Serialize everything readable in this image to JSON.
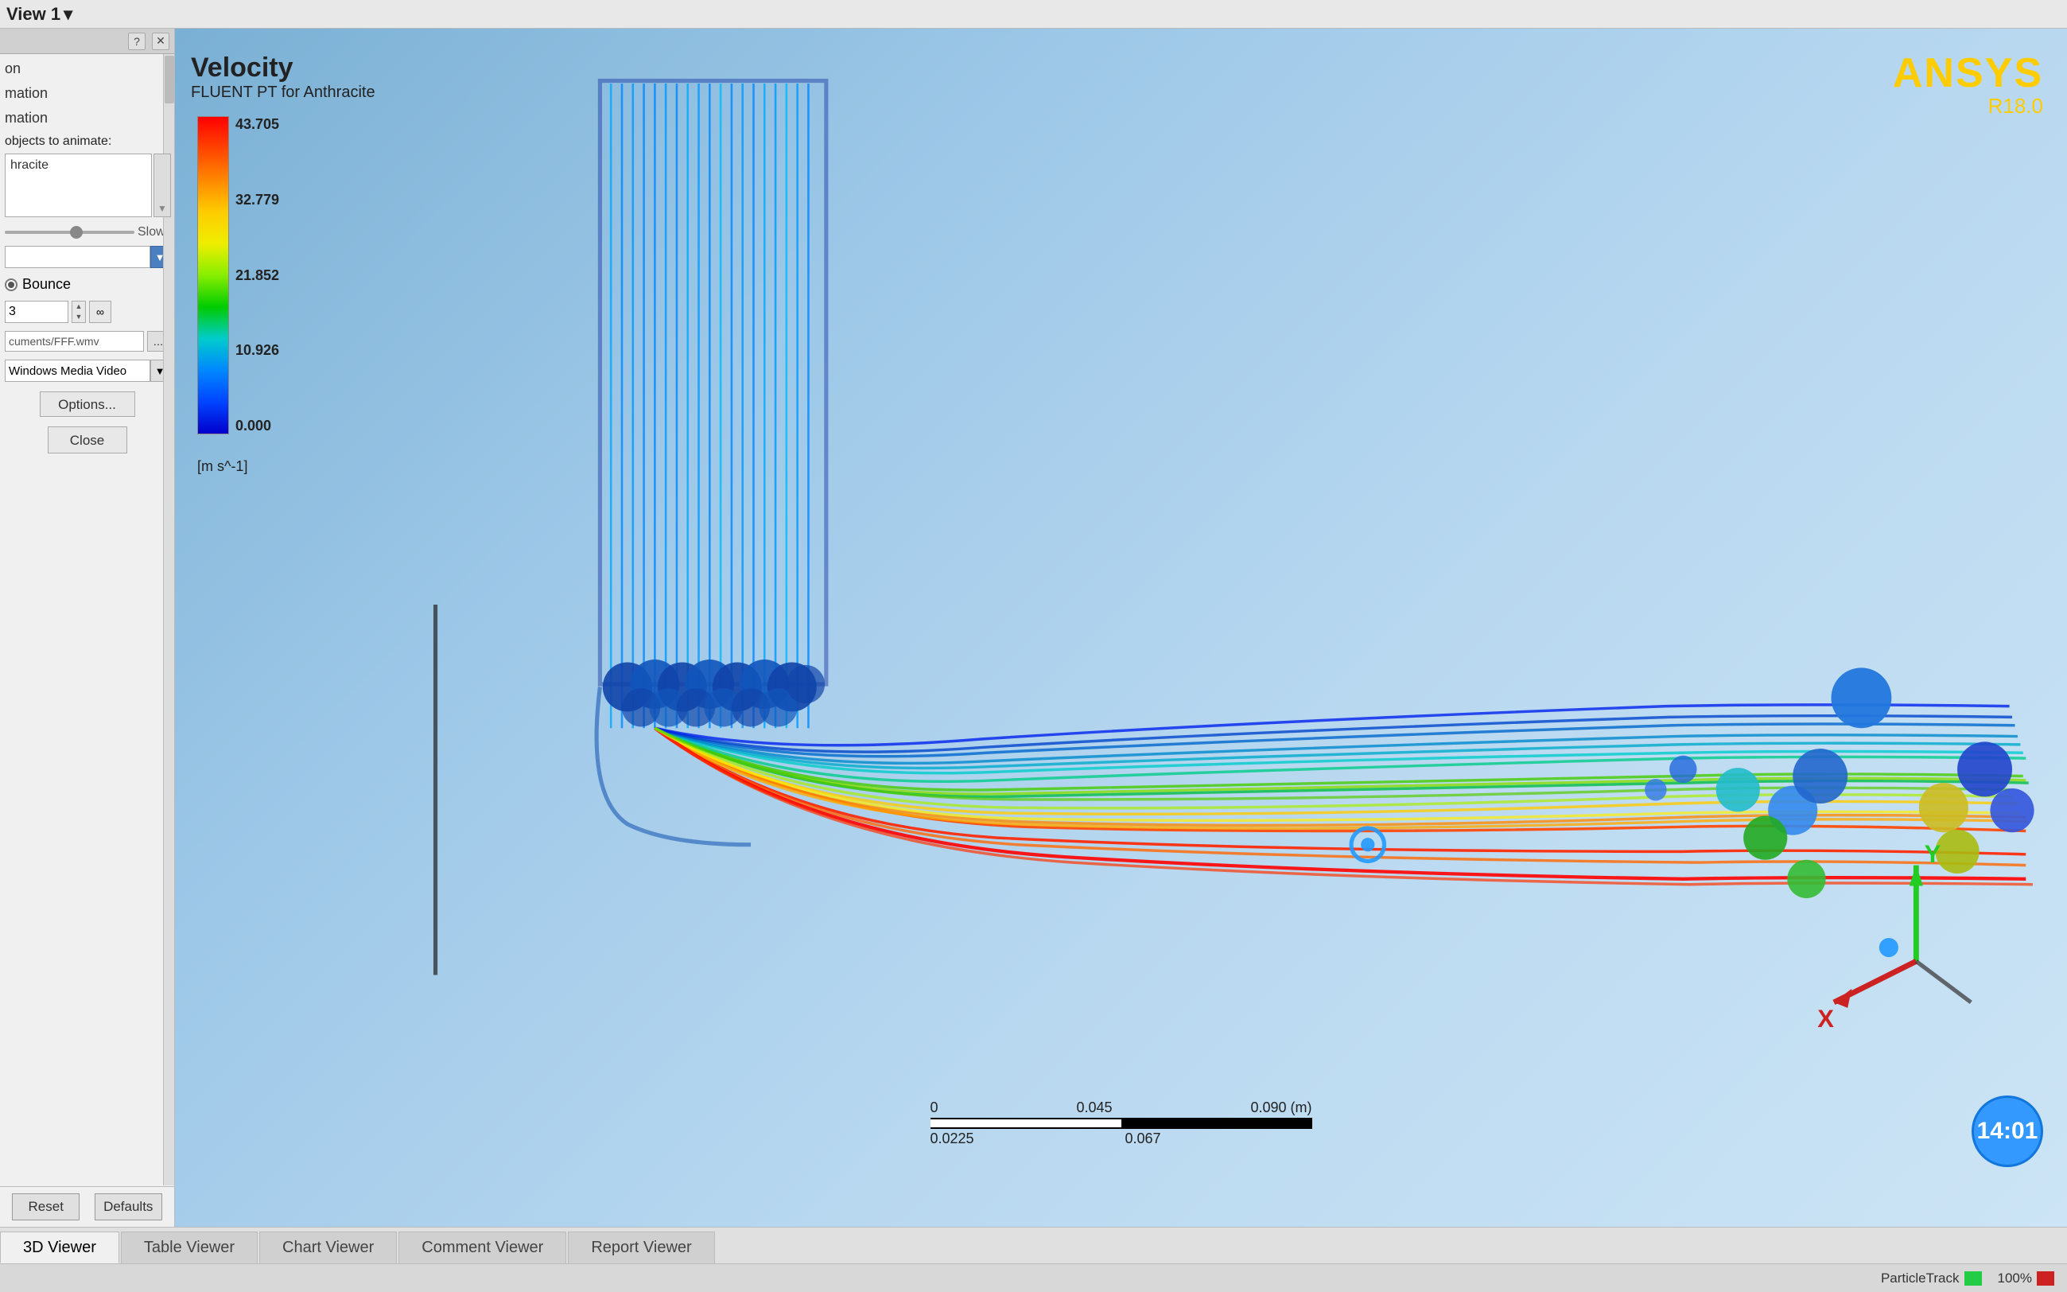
{
  "topbar": {
    "view_label": "View 1",
    "chevron": "▾"
  },
  "left_panel": {
    "help_btn": "?",
    "close_btn": "✕",
    "rows": [
      {
        "label": "on"
      },
      {
        "label": "mation"
      },
      {
        "label": "mation"
      }
    ],
    "objects_label": "objects to animate:",
    "objects_item": "hracite",
    "slider_label": "Slow",
    "bounce_label": "Bounce",
    "number_value": "3",
    "infinity_symbol": "∞",
    "file_path": "cuments/FFF.wmv",
    "format_label": "Windows Media Video",
    "options_btn": "Options...",
    "dialog_close_btn": "Close",
    "reset_btn": "Reset",
    "defaults_btn": "Defaults"
  },
  "colorbar": {
    "title": "Velocity",
    "subtitle": "FLUENT PT for Anthracite",
    "max": "43.705",
    "val1": "32.779",
    "val2": "21.852",
    "val3": "10.926",
    "min": "0.000",
    "unit": "[m s^-1]"
  },
  "ansys": {
    "brand": "ANSYS",
    "version": "R18.0"
  },
  "scale_bar": {
    "top_labels": [
      "0",
      "0.045",
      "0.090 (m)"
    ],
    "bottom_labels": [
      "0.0225",
      "0.067"
    ]
  },
  "timer": {
    "time": "14:01"
  },
  "tabs": [
    {
      "label": "3D Viewer",
      "active": true
    },
    {
      "label": "Table Viewer",
      "active": false
    },
    {
      "label": "Chart Viewer",
      "active": false
    },
    {
      "label": "Comment Viewer",
      "active": false
    },
    {
      "label": "Report Viewer",
      "active": false
    }
  ],
  "status_bar": {
    "particle_track_label": "ParticleTrack",
    "zoom_level": "100%"
  }
}
